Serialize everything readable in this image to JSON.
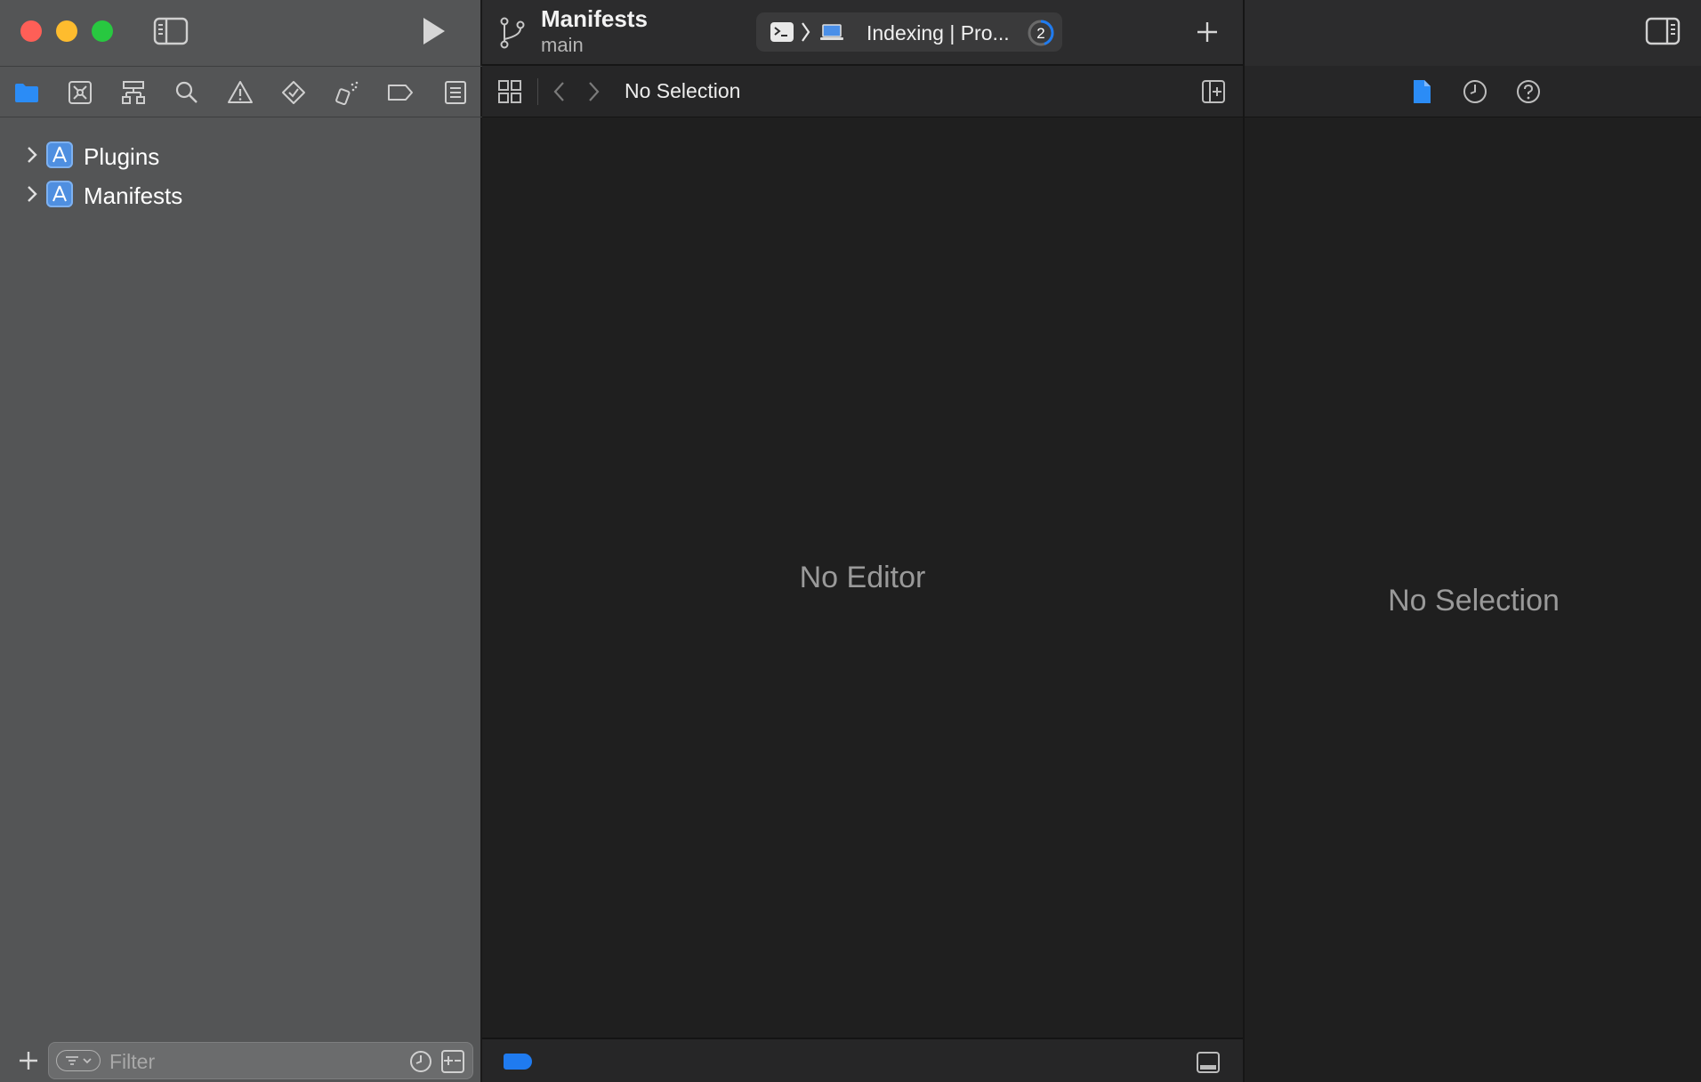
{
  "toolbar": {
    "project_name": "Manifests",
    "branch": "main",
    "activity_text": "Indexing | Pro...",
    "activity_count": "2"
  },
  "navigator": {
    "tabs": [
      "project-navigator",
      "source-control-navigator",
      "symbol-navigator",
      "find-navigator",
      "issue-navigator",
      "test-navigator",
      "debug-navigator",
      "breakpoint-navigator",
      "report-navigator"
    ],
    "items": [
      {
        "label": "Plugins",
        "icon": "app-target-icon"
      },
      {
        "label": "Manifests",
        "icon": "app-target-icon"
      }
    ],
    "filter_placeholder": "Filter"
  },
  "editor": {
    "jump_title": "No Selection",
    "empty_text": "No Editor"
  },
  "inspector": {
    "tabs": [
      "file-inspector",
      "history-inspector",
      "quick-help-inspector"
    ],
    "empty_text": "No Selection"
  },
  "colors": {
    "accent": "#1f7bf0",
    "close": "#fe5f57",
    "minimize": "#febc2e",
    "zoom": "#28c840",
    "navigator_bg": "#545556",
    "editor_bg": "#1f1f1f"
  }
}
